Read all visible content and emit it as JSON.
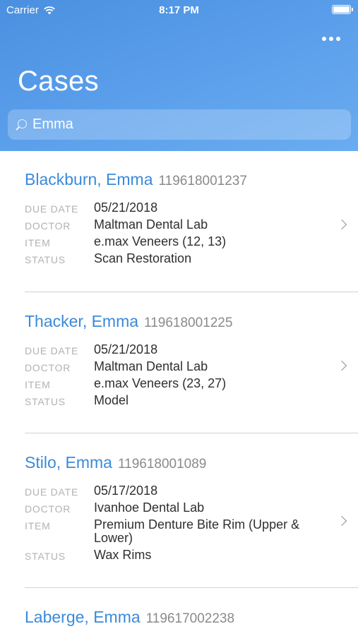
{
  "status_bar": {
    "carrier": "Carrier",
    "time": "8:17 PM"
  },
  "header": {
    "title": "Cases"
  },
  "search": {
    "value": "Emma"
  },
  "labels": {
    "due_date": "DUE DATE",
    "doctor": "DOCTOR",
    "item": "ITEM",
    "status": "STATUS"
  },
  "cases": [
    {
      "name": "Blackburn, Emma",
      "number": "119618001237",
      "due_date": "05/21/2018",
      "doctor": "Maltman Dental Lab",
      "item": "e.max Veneers (12, 13)",
      "status": "Scan Restoration"
    },
    {
      "name": "Thacker, Emma",
      "number": "119618001225",
      "due_date": "05/21/2018",
      "doctor": "Maltman Dental Lab",
      "item": "e.max Veneers (23, 27)",
      "status": "Model"
    },
    {
      "name": "Stilo, Emma",
      "number": "119618001089",
      "due_date": "05/17/2018",
      "doctor": "Ivanhoe Dental Lab",
      "item": "Premium Denture Bite Rim (Upper & Lower)",
      "status": "Wax Rims"
    },
    {
      "name": "Laberge, Emma",
      "number": "119617002238"
    }
  ]
}
